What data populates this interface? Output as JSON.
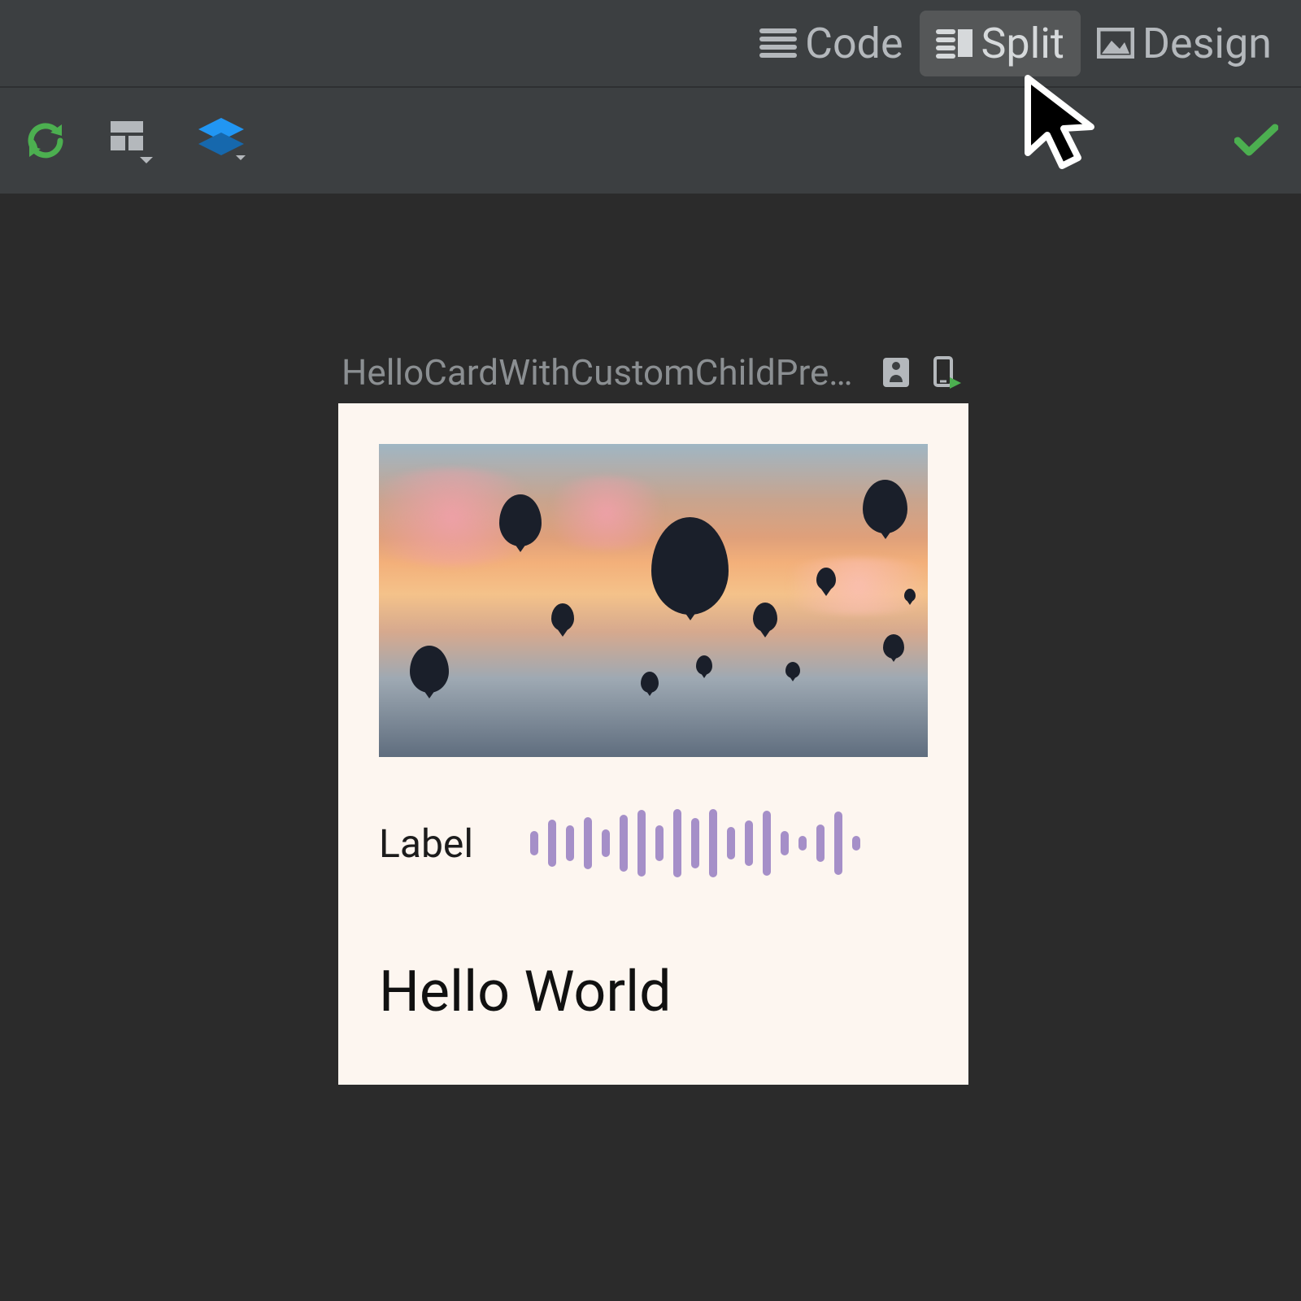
{
  "viewmode": {
    "tabs": [
      {
        "id": "code",
        "label": "Code",
        "icon": "list-icon",
        "active": false
      },
      {
        "id": "split",
        "label": "Split",
        "icon": "split-icon",
        "active": true
      },
      {
        "id": "design",
        "label": "Design",
        "icon": "image-icon",
        "active": false
      }
    ]
  },
  "toolbar": {
    "refresh": "refresh-icon",
    "surface": "surface-icon",
    "layers": "layers-icon",
    "status_ok": "check-icon"
  },
  "preview": {
    "title": "HelloCardWithCustomChildPrev...",
    "deep_link_icon": "deeplink-icon",
    "device_icon": "device-run-icon"
  },
  "card": {
    "label": "Label",
    "greeting": "Hello World",
    "waveform_heights": [
      30,
      58,
      44,
      64,
      34,
      70,
      82,
      44,
      84,
      62,
      84,
      40,
      56,
      80,
      30,
      18,
      46,
      78,
      18
    ]
  },
  "colors": {
    "bg": "#2b2b2b",
    "panel": "#3c3f41",
    "accent_green": "#4caf50",
    "accent_blue": "#2196f3",
    "wave_purple": "#a58fc8",
    "card_bg": "#fdf6f0"
  }
}
